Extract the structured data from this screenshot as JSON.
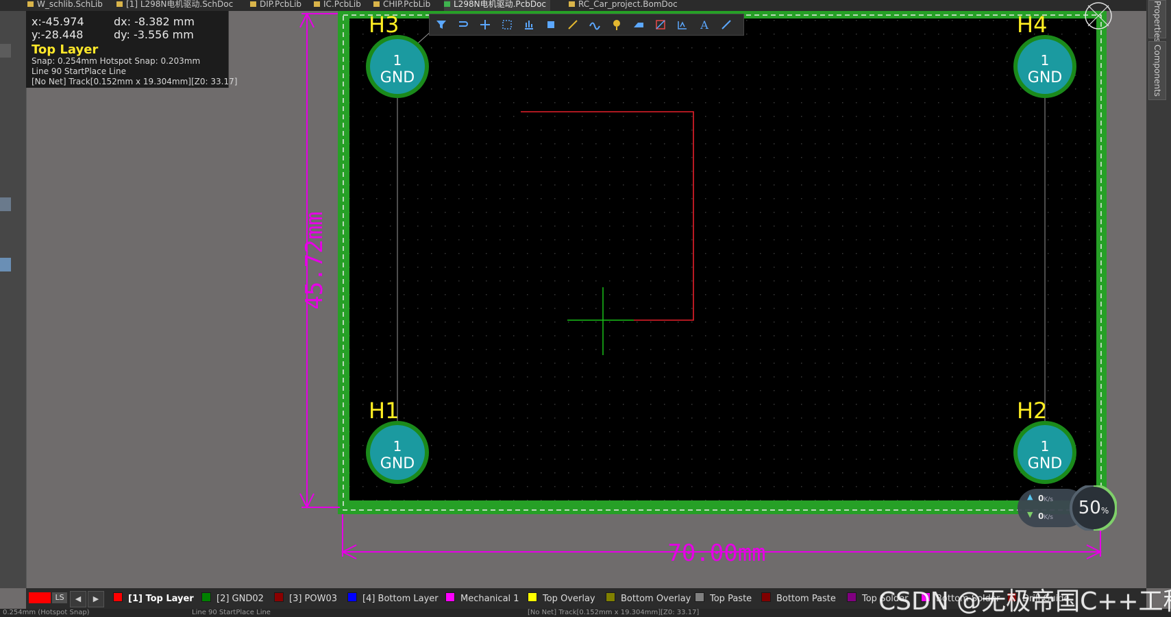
{
  "tabs": [
    {
      "label": "W_schlib.SchLib",
      "active": false
    },
    {
      "label": "[1] L298N电机驱动.SchDoc",
      "active": false
    },
    {
      "label": "DIP.PcbLib",
      "active": false
    },
    {
      "label": "IC.PcbLib",
      "active": false
    },
    {
      "label": "CHIP.PcbLib",
      "active": false
    },
    {
      "label": "L298N电机驱动.PcbDoc",
      "active": true
    },
    {
      "label": "RC_Car_project.BomDoc",
      "active": false
    }
  ],
  "right_panels": [
    "Properties",
    "Components"
  ],
  "hud": {
    "x": "x:-45.974",
    "dx": "dx: -8.382 mm",
    "y": "y:-28.448",
    "dy": "dy: -3.556 mm",
    "layer": "Top Layer",
    "snap": "Snap: 0.254mm Hotspot Snap: 0.203mm",
    "mode": "Line 90 StartPlace Line",
    "track": "[No Net] Track[0.152mm x 19.304mm][Z0: 33.17]"
  },
  "toolbar_icons": [
    "filter-icon",
    "route-icon",
    "crosshair-icon",
    "select-rect-icon",
    "align-icon",
    "component-icon",
    "interactive-route-icon",
    "diff-pair-icon",
    "pad-icon",
    "fill-icon",
    "polygon-icon",
    "via-icon",
    "text-icon",
    "line-icon"
  ],
  "board": {
    "holes": [
      {
        "designator": "H3",
        "pad_number": "1",
        "net": "GND"
      },
      {
        "designator": "H4",
        "pad_number": "1",
        "net": "GND"
      },
      {
        "designator": "H1",
        "pad_number": "1",
        "net": "GND"
      },
      {
        "designator": "H2",
        "pad_number": "1",
        "net": "GND"
      }
    ],
    "dim_height": "45.72mm",
    "dim_width": "70.00mm"
  },
  "net_monitor": {
    "up": "0",
    "down": "0",
    "unit": "K/s",
    "percent": "50",
    "percent_unit": "%"
  },
  "layer_set": {
    "label": "LS"
  },
  "layers": [
    {
      "label": "[1] Top Layer",
      "color": "#ff0000",
      "active": true
    },
    {
      "label": "[2] GND02",
      "color": "#008000",
      "active": false
    },
    {
      "label": "[3] POW03",
      "color": "#8b0000",
      "active": false
    },
    {
      "label": "[4] Bottom Layer",
      "color": "#0000ff",
      "active": false
    },
    {
      "label": "Mechanical 1",
      "color": "#ff00ff",
      "active": false
    },
    {
      "label": "Top Overlay",
      "color": "#ffff00",
      "active": false
    },
    {
      "label": "Bottom Overlay",
      "color": "#808000",
      "active": false
    },
    {
      "label": "Top Paste",
      "color": "#808080",
      "active": false
    },
    {
      "label": "Bottom Paste",
      "color": "#800000",
      "active": false
    },
    {
      "label": "Top Solder",
      "color": "#800080",
      "active": false
    },
    {
      "label": "Bottom Solder",
      "color": "#ff00ff",
      "active": false
    },
    {
      "label": "Drill Guide",
      "color": "#8b0000",
      "active": false
    }
  ],
  "bottom_status": {
    "left": "0.254mm (Hotspot Snap)",
    "middle": "Line 90 StartPlace Line",
    "right": "[No Net] Track[0.152mm x 19.304mm][Z0: 33.17]"
  },
  "watermark": "CSDN @无极帝国C++工程师"
}
